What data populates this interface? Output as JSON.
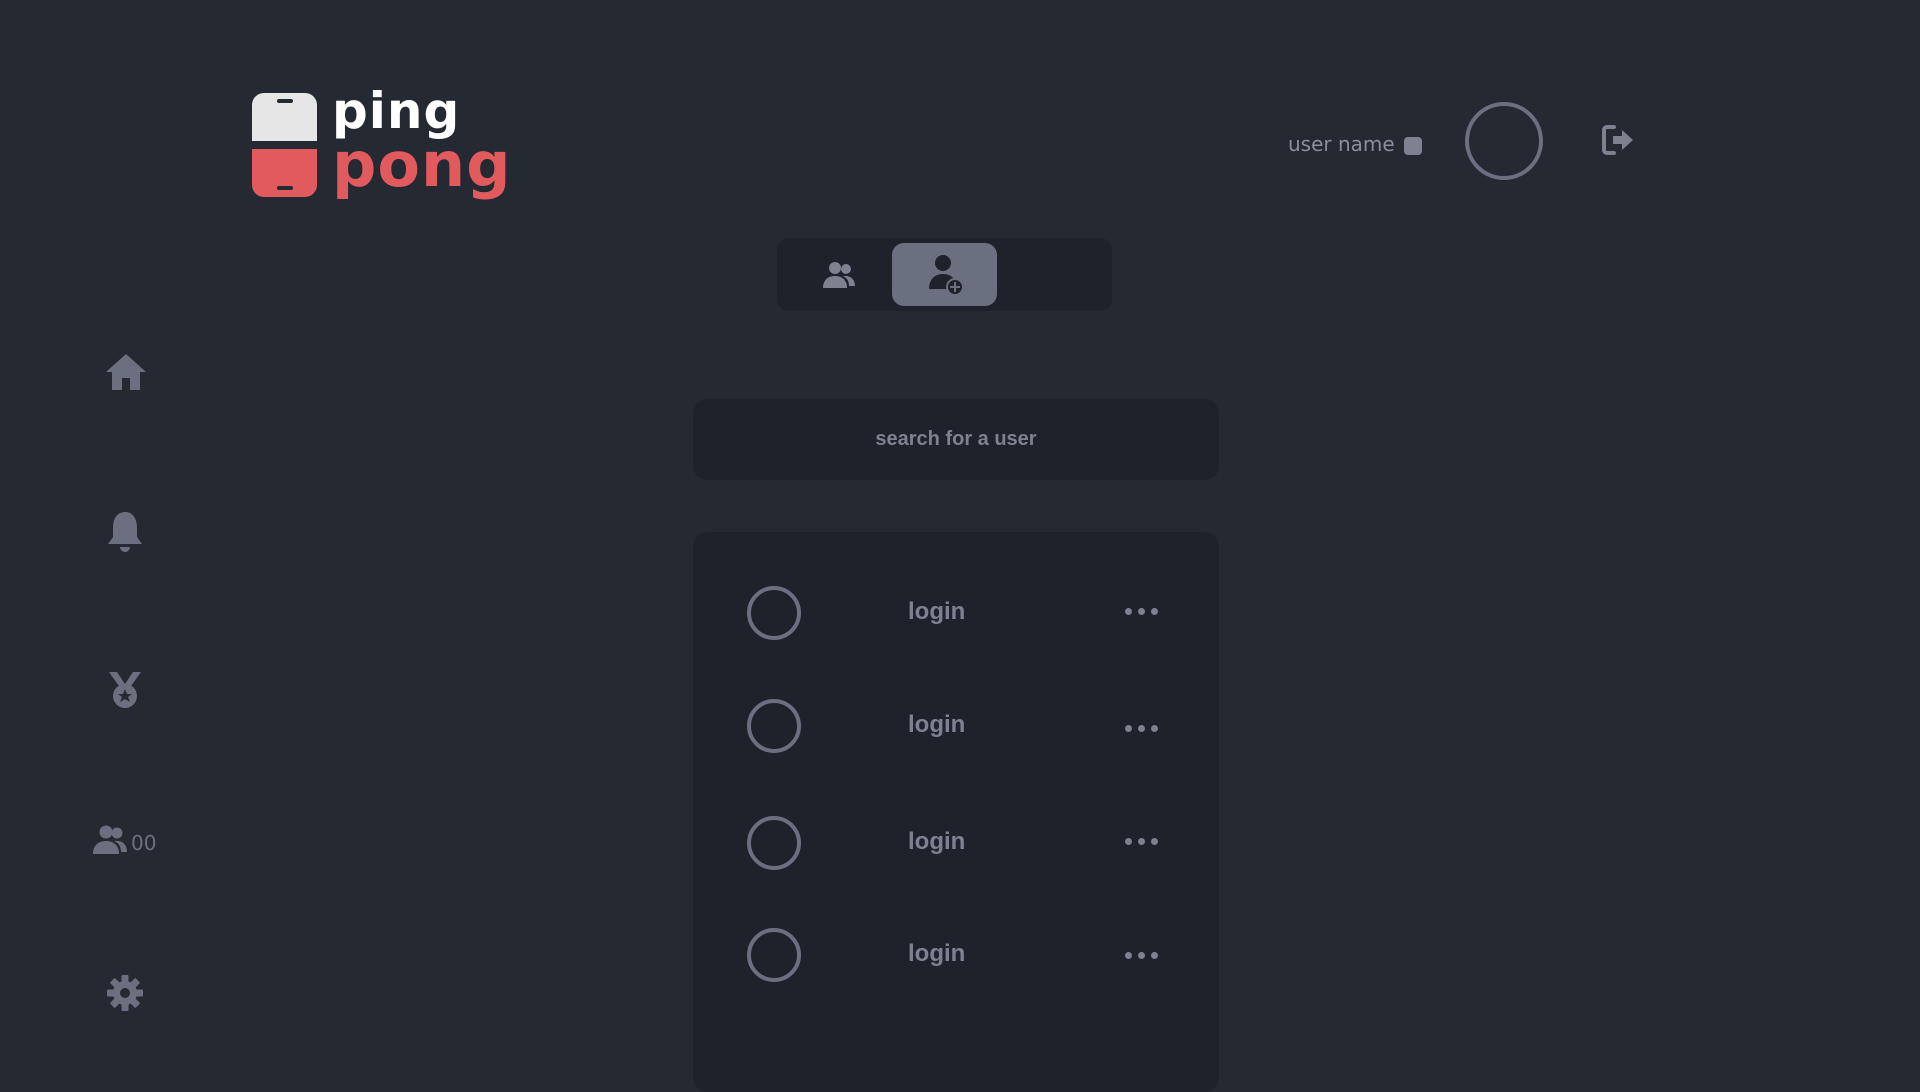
{
  "logo": {
    "line1": "ping",
    "line2": "pong"
  },
  "header": {
    "username": "user name",
    "logout_icon": "logout-icon"
  },
  "tabs": [
    {
      "icon": "friends-icon",
      "active": false
    },
    {
      "icon": "add-user-icon",
      "active": true
    }
  ],
  "sidebar": {
    "items": [
      {
        "icon": "home-icon"
      },
      {
        "icon": "bell-icon"
      },
      {
        "icon": "medal-icon"
      },
      {
        "icon": "users-icon",
        "count": "00"
      },
      {
        "icon": "gear-icon"
      }
    ]
  },
  "search": {
    "placeholder": "search for a user"
  },
  "users": [
    {
      "login": "login"
    },
    {
      "login": "login"
    },
    {
      "login": "login"
    },
    {
      "login": "login"
    }
  ],
  "colors": {
    "background": "#252932",
    "panel": "#1e222b",
    "accent": "#e05a5e",
    "muted": "#6b7080"
  }
}
